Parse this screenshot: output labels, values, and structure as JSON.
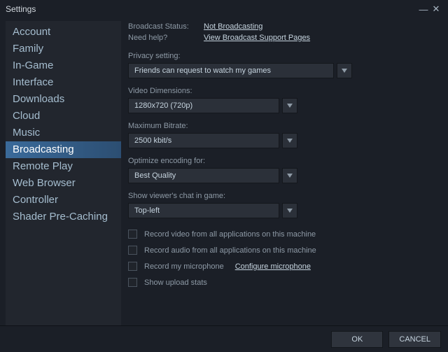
{
  "window": {
    "title": "Settings"
  },
  "sidebar": {
    "items": [
      {
        "label": "Account"
      },
      {
        "label": "Family"
      },
      {
        "label": "In-Game"
      },
      {
        "label": "Interface"
      },
      {
        "label": "Downloads"
      },
      {
        "label": "Cloud"
      },
      {
        "label": "Music"
      },
      {
        "label": "Broadcasting"
      },
      {
        "label": "Remote Play"
      },
      {
        "label": "Web Browser"
      },
      {
        "label": "Controller"
      },
      {
        "label": "Shader Pre-Caching"
      }
    ],
    "active_index": 7
  },
  "status": {
    "broadcast_label": "Broadcast Status:",
    "broadcast_value": "Not Broadcasting",
    "help_label": "Need help?",
    "help_value": "View Broadcast Support Pages"
  },
  "fields": {
    "privacy": {
      "label": "Privacy setting:",
      "value": "Friends can request to watch my games"
    },
    "dimensions": {
      "label": "Video Dimensions:",
      "value": "1280x720 (720p)"
    },
    "bitrate": {
      "label": "Maximum Bitrate:",
      "value": "2500 kbit/s"
    },
    "encoding": {
      "label": "Optimize encoding for:",
      "value": "Best Quality"
    },
    "chat": {
      "label": "Show viewer's chat in game:",
      "value": "Top-left"
    }
  },
  "checks": {
    "record_video": "Record video from all applications on this machine",
    "record_audio": "Record audio from all applications on this machine",
    "record_mic": "Record my microphone",
    "configure_mic": "Configure microphone",
    "upload_stats": "Show upload stats"
  },
  "footer": {
    "ok": "OK",
    "cancel": "CANCEL"
  }
}
